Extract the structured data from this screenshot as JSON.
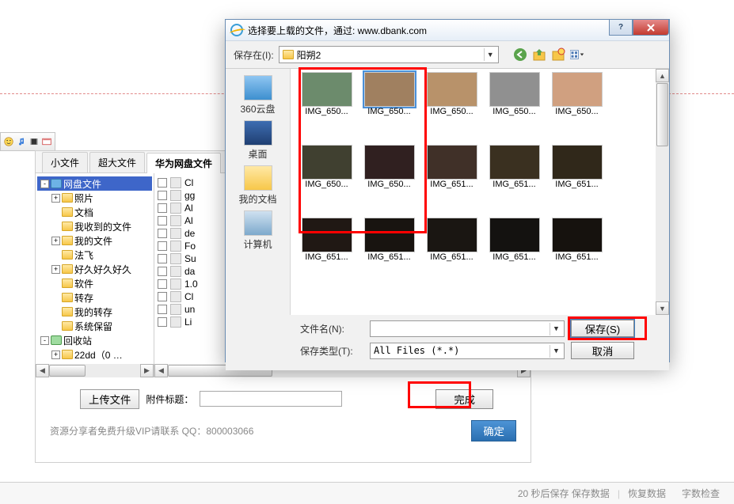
{
  "lower_panel": {
    "tabs": [
      "小文件",
      "超大文件",
      "华为网盘文件"
    ],
    "active_tab": 2,
    "upload_button": "上传文件",
    "attach_label": "附件标题：",
    "finish_button": "完成",
    "vip_text": "资源分享者免费升级VIP请联系 QQ：800003066",
    "confirm_button": "确定",
    "tree": [
      {
        "depth": 0,
        "toggle": "-",
        "icon": "disk",
        "label": "网盘文件",
        "sel": true
      },
      {
        "depth": 1,
        "toggle": "+",
        "icon": "folder",
        "label": "照片"
      },
      {
        "depth": 1,
        "toggle": "",
        "icon": "folder",
        "label": "文档"
      },
      {
        "depth": 1,
        "toggle": "",
        "icon": "folder",
        "label": "我收到的文件"
      },
      {
        "depth": 1,
        "toggle": "+",
        "icon": "folder",
        "label": "我的文件"
      },
      {
        "depth": 1,
        "toggle": "",
        "icon": "folder",
        "label": "法飞"
      },
      {
        "depth": 1,
        "toggle": "+",
        "icon": "folder",
        "label": "好久好久好久"
      },
      {
        "depth": 1,
        "toggle": "",
        "icon": "folder",
        "label": "软件"
      },
      {
        "depth": 1,
        "toggle": "",
        "icon": "folder",
        "label": "转存"
      },
      {
        "depth": 1,
        "toggle": "",
        "icon": "folder",
        "label": "我的转存"
      },
      {
        "depth": 1,
        "toggle": "",
        "icon": "folder",
        "label": "系统保留"
      },
      {
        "depth": 0,
        "toggle": "-",
        "icon": "recycle",
        "label": "回收站"
      },
      {
        "depth": 1,
        "toggle": "+",
        "icon": "folder",
        "label": "22dd（0 …"
      }
    ],
    "file_list": [
      "Cl",
      "gg",
      "Al",
      "Al",
      "de",
      "Fo",
      "Su",
      "da",
      "1.0",
      "Cl",
      "un",
      "Li"
    ]
  },
  "status_bar": {
    "autosave": "20 秒后保存 保存数据",
    "restore": "恢复数据",
    "word_check": "字数检查"
  },
  "dialog": {
    "title": "选择要上载的文件，通过: www.dbank.com",
    "look_in_label": "保存在(I):",
    "look_in_value": "阳朔2",
    "places": [
      "360云盘",
      "桌面",
      "我的文档",
      "计算机"
    ],
    "thumbs_row1": [
      "IMG_650...",
      "IMG_650...",
      "IMG_650...",
      "IMG_650...",
      "IMG_650..."
    ],
    "thumbs_row2": [
      "IMG_650...",
      "IMG_650...",
      "IMG_651...",
      "IMG_651...",
      "IMG_651..."
    ],
    "thumbs_row3": [
      "IMG_651...",
      "IMG_651...",
      "IMG_651...",
      "IMG_651...",
      "IMG_651..."
    ],
    "filename_label": "文件名(N):",
    "filetype_label": "保存类型(T):",
    "filetype_value": "All Files (*.*)",
    "save_button": "保存(S)",
    "cancel_button": "取消"
  }
}
